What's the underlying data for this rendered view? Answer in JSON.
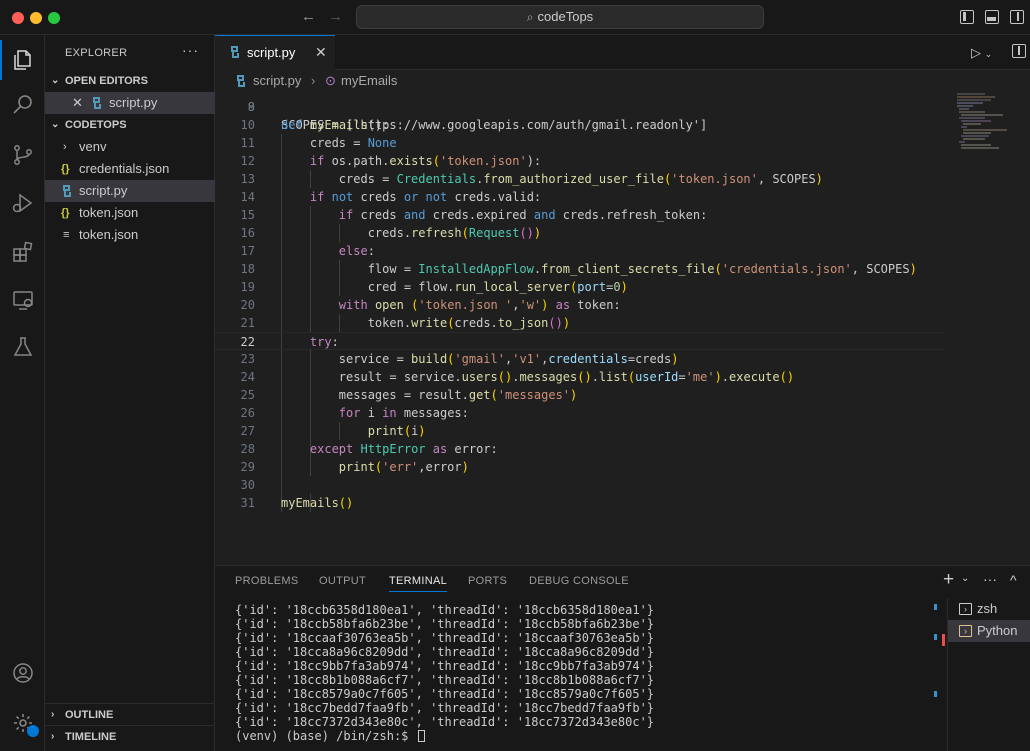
{
  "window": {
    "title": "codeTops"
  },
  "activity": [
    "files-icon",
    "search-icon",
    "source-control-icon",
    "run-debug-icon",
    "extensions-icon",
    "remote-explorer-icon",
    "testing-icon",
    "account-icon",
    "settings-gear-icon"
  ],
  "sidebar": {
    "title": "EXPLORER",
    "more": "···",
    "open_editors": {
      "label": "OPEN EDITORS",
      "items": [
        {
          "name": "script.py"
        }
      ]
    },
    "project": {
      "label": "CODETOPS",
      "items": [
        {
          "name": "venv",
          "icon": "chevron"
        },
        {
          "name": "credentials.json",
          "icon": "braces"
        },
        {
          "name": "script.py",
          "icon": "python"
        },
        {
          "name": "token.json",
          "icon": "braces"
        },
        {
          "name": "token.json",
          "icon": "lines"
        }
      ]
    },
    "outline": "OUTLINE",
    "timeline": "TIMELINE"
  },
  "editor": {
    "tab": {
      "label": "script.py",
      "close": "✕"
    },
    "breadcrumb": {
      "file": "script.py",
      "symbol": "myEmails"
    },
    "partial_line": {
      "number": "8",
      "text": "SCOPES = ['https://www.googleapis.com/auth/gmail.readonly']"
    },
    "line_numbers": [
      "9",
      "10",
      "11",
      "12",
      "13",
      "14",
      "15",
      "16",
      "17",
      "18",
      "19",
      "20",
      "21",
      "22",
      "23",
      "24",
      "25",
      "26",
      "27",
      "28",
      "29",
      "30",
      "31"
    ],
    "current_line": "22",
    "code": {
      "l10a": "def",
      "l10b": "myEmails",
      "l10c": "():",
      "l11a": "creds = ",
      "l11b": "None",
      "l12a": "if",
      "l12b": " os.path.",
      "l12c": "exists",
      "l12d": "(",
      "l12e": "'token.json'",
      "l12f": "):",
      "l13a": "creds = ",
      "l13b": "Credentials",
      "l13c": ".",
      "l13d": "from_authorized_user_file",
      "l13e": "(",
      "l13f": "'token.json'",
      "l13g": ", SCOPES",
      "l13h": ")",
      "l14a": "if",
      "l14b": "not",
      "l14c": " creds ",
      "l14d": "or",
      "l14e": "not",
      "l14f": " creds.valid:",
      "l15a": "if",
      "l15b": " creds ",
      "l15c": "and",
      "l15d": " creds.expired ",
      "l15e": "and",
      "l15f": " creds.refresh_token:",
      "l16a": "creds.",
      "l16b": "refresh",
      "l16c": "(",
      "l16d": "Request",
      "l16e": "()",
      "l16f": ")",
      "l17a": "else",
      "l18a": "flow = ",
      "l18b": "InstalledAppFlow",
      "l18c": ".",
      "l18d": "from_client_secrets_file",
      "l18e": "(",
      "l18f": "'credentials.json'",
      "l18g": ", SCOPES",
      "l18h": ")",
      "l19a": "cred = flow.",
      "l19b": "run_local_server",
      "l19c": "(",
      "l19d": "port",
      "l19e": "=",
      "l19f": "0",
      "l19g": ")",
      "l20a": "with",
      "l20b": "open",
      "l20c": "(",
      "l20d": "'token.json '",
      "l20e": ",",
      "l20f": "'w'",
      "l20g": ")",
      "l20h": "as",
      "l20i": " token:",
      "l21a": "token.",
      "l21b": "write",
      "l21c": "(",
      "l21d": "creds.",
      "l21e": "to_json",
      "l21f": "()",
      "l21g": ")",
      "l22a": "try",
      "l23a": "service = ",
      "l23b": "build",
      "l23c": "(",
      "l23d": "'gmail'",
      "l23e": ",",
      "l23f": "'v1'",
      "l23g": ",",
      "l23h": "credentials",
      "l23i": "=creds",
      "l23j": ")",
      "l24a": "result = service.",
      "l24b": "users",
      "l24c": "()",
      "l24d": ".",
      "l24e": "messages",
      "l24f": "()",
      "l24g": ".",
      "l24h": "list",
      "l24i": "(",
      "l24j": "userId",
      "l24k": "=",
      "l24l": "'me'",
      "l24m": ")",
      "l24n": ".",
      "l24o": "execute",
      "l24p": "()",
      "l25a": "messages = result.",
      "l25b": "get",
      "l25c": "(",
      "l25d": "'messages'",
      "l25e": ")",
      "l26a": "for",
      "l26b": " i ",
      "l26c": "in",
      "l26d": " messages:",
      "l27a": "print",
      "l27b": "(",
      "l27c": "i",
      "l27d": ")",
      "l28a": "except",
      "l28b": " HttpError ",
      "l28c": "as",
      "l28d": " error:",
      "l29a": "print",
      "l29b": "(",
      "l29c": "'err'",
      "l29d": ",error",
      "l29e": ")",
      "l31a": "myEmails",
      "l31b": "()"
    }
  },
  "panel": {
    "tabs": [
      "PROBLEMS",
      "OUTPUT",
      "TERMINAL",
      "PORTS",
      "DEBUG CONSOLE"
    ],
    "active_tab": "TERMINAL",
    "actions": {
      "add": "+",
      "more": "···",
      "chevron": "^"
    },
    "terminal_lines": [
      "{'id': '18ccb6358d180ea1', 'threadId': '18ccb6358d180ea1'}",
      "{'id': '18ccb58bfa6b23be', 'threadId': '18ccb58bfa6b23be'}",
      "{'id': '18ccaaf30763ea5b', 'threadId': '18ccaaf30763ea5b'}",
      "{'id': '18cca8a96c8209dd', 'threadId': '18cca8a96c8209dd'}",
      "{'id': '18cc9bb7fa3ab974', 'threadId': '18cc9bb7fa3ab974'}",
      "{'id': '18cc8b1b088a6cf7', 'threadId': '18cc8b1b088a6cf7'}",
      "{'id': '18cc8579a0c7f605', 'threadId': '18cc8579a0c7f605'}",
      "{'id': '18cc7bedd7faa9fb', 'threadId': '18cc7bedd7faa9fb'}",
      "{'id': '18cc7372d343e80c', 'threadId': '18cc7372d343e80c'}"
    ],
    "prompt": "(venv) (base) /bin/zsh:$ ",
    "terminal_list": [
      {
        "name": "zsh"
      },
      {
        "name": "Python"
      }
    ]
  },
  "colors": {
    "accent": "#0078d4",
    "keyword": "#569cd6",
    "control": "#c586c0",
    "function": "#dcdcaa",
    "string": "#ce9178",
    "python_icon": "#519aba",
    "json_icon": "#cbcb41"
  }
}
